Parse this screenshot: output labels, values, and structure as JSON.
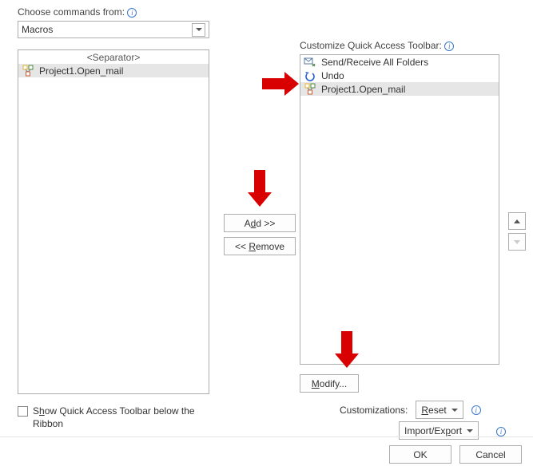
{
  "labels": {
    "choose_from": "Choose commands from:",
    "customize_qat": "Customize Quick Access Toolbar:"
  },
  "left": {
    "dropdown_value": "Macros",
    "items": {
      "separator": "<Separator>",
      "macro": "Project1.Open_mail"
    }
  },
  "right": {
    "items": {
      "send_receive": "Send/Receive All Folders",
      "undo": "Undo",
      "macro": "Project1.Open_mail"
    }
  },
  "buttons": {
    "add_prefix": "A",
    "add_u": "d",
    "add_suffix": "d >>",
    "remove_prefix": "<< ",
    "remove_u": "R",
    "remove_suffix": "emove",
    "modify_u": "M",
    "modify_suffix": "odify...",
    "ok": "OK",
    "cancel": "Cancel"
  },
  "customizations": {
    "label": "Customizations:",
    "reset_u": "R",
    "reset_suffix": "eset",
    "import_prefix": "Import/Ex",
    "import_u": "p",
    "import_suffix": "ort"
  },
  "checkbox": {
    "prefix": "S",
    "mid": "h",
    "suffix": "ow Quick Access Toolbar below the Ribbon"
  }
}
